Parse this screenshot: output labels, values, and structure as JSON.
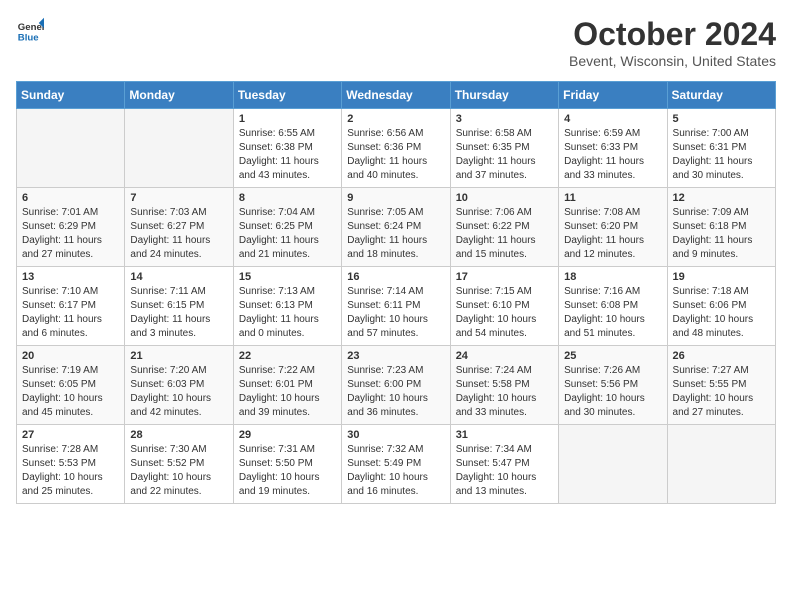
{
  "header": {
    "logo": {
      "general": "General",
      "blue": "Blue"
    },
    "title": "October 2024",
    "subtitle": "Bevent, Wisconsin, United States"
  },
  "weekdays": [
    "Sunday",
    "Monday",
    "Tuesday",
    "Wednesday",
    "Thursday",
    "Friday",
    "Saturday"
  ],
  "weeks": [
    [
      {
        "day": "",
        "info": ""
      },
      {
        "day": "",
        "info": ""
      },
      {
        "day": "1",
        "info": "Sunrise: 6:55 AM\nSunset: 6:38 PM\nDaylight: 11 hours and 43 minutes."
      },
      {
        "day": "2",
        "info": "Sunrise: 6:56 AM\nSunset: 6:36 PM\nDaylight: 11 hours and 40 minutes."
      },
      {
        "day": "3",
        "info": "Sunrise: 6:58 AM\nSunset: 6:35 PM\nDaylight: 11 hours and 37 minutes."
      },
      {
        "day": "4",
        "info": "Sunrise: 6:59 AM\nSunset: 6:33 PM\nDaylight: 11 hours and 33 minutes."
      },
      {
        "day": "5",
        "info": "Sunrise: 7:00 AM\nSunset: 6:31 PM\nDaylight: 11 hours and 30 minutes."
      }
    ],
    [
      {
        "day": "6",
        "info": "Sunrise: 7:01 AM\nSunset: 6:29 PM\nDaylight: 11 hours and 27 minutes."
      },
      {
        "day": "7",
        "info": "Sunrise: 7:03 AM\nSunset: 6:27 PM\nDaylight: 11 hours and 24 minutes."
      },
      {
        "day": "8",
        "info": "Sunrise: 7:04 AM\nSunset: 6:25 PM\nDaylight: 11 hours and 21 minutes."
      },
      {
        "day": "9",
        "info": "Sunrise: 7:05 AM\nSunset: 6:24 PM\nDaylight: 11 hours and 18 minutes."
      },
      {
        "day": "10",
        "info": "Sunrise: 7:06 AM\nSunset: 6:22 PM\nDaylight: 11 hours and 15 minutes."
      },
      {
        "day": "11",
        "info": "Sunrise: 7:08 AM\nSunset: 6:20 PM\nDaylight: 11 hours and 12 minutes."
      },
      {
        "day": "12",
        "info": "Sunrise: 7:09 AM\nSunset: 6:18 PM\nDaylight: 11 hours and 9 minutes."
      }
    ],
    [
      {
        "day": "13",
        "info": "Sunrise: 7:10 AM\nSunset: 6:17 PM\nDaylight: 11 hours and 6 minutes."
      },
      {
        "day": "14",
        "info": "Sunrise: 7:11 AM\nSunset: 6:15 PM\nDaylight: 11 hours and 3 minutes."
      },
      {
        "day": "15",
        "info": "Sunrise: 7:13 AM\nSunset: 6:13 PM\nDaylight: 11 hours and 0 minutes."
      },
      {
        "day": "16",
        "info": "Sunrise: 7:14 AM\nSunset: 6:11 PM\nDaylight: 10 hours and 57 minutes."
      },
      {
        "day": "17",
        "info": "Sunrise: 7:15 AM\nSunset: 6:10 PM\nDaylight: 10 hours and 54 minutes."
      },
      {
        "day": "18",
        "info": "Sunrise: 7:16 AM\nSunset: 6:08 PM\nDaylight: 10 hours and 51 minutes."
      },
      {
        "day": "19",
        "info": "Sunrise: 7:18 AM\nSunset: 6:06 PM\nDaylight: 10 hours and 48 minutes."
      }
    ],
    [
      {
        "day": "20",
        "info": "Sunrise: 7:19 AM\nSunset: 6:05 PM\nDaylight: 10 hours and 45 minutes."
      },
      {
        "day": "21",
        "info": "Sunrise: 7:20 AM\nSunset: 6:03 PM\nDaylight: 10 hours and 42 minutes."
      },
      {
        "day": "22",
        "info": "Sunrise: 7:22 AM\nSunset: 6:01 PM\nDaylight: 10 hours and 39 minutes."
      },
      {
        "day": "23",
        "info": "Sunrise: 7:23 AM\nSunset: 6:00 PM\nDaylight: 10 hours and 36 minutes."
      },
      {
        "day": "24",
        "info": "Sunrise: 7:24 AM\nSunset: 5:58 PM\nDaylight: 10 hours and 33 minutes."
      },
      {
        "day": "25",
        "info": "Sunrise: 7:26 AM\nSunset: 5:56 PM\nDaylight: 10 hours and 30 minutes."
      },
      {
        "day": "26",
        "info": "Sunrise: 7:27 AM\nSunset: 5:55 PM\nDaylight: 10 hours and 27 minutes."
      }
    ],
    [
      {
        "day": "27",
        "info": "Sunrise: 7:28 AM\nSunset: 5:53 PM\nDaylight: 10 hours and 25 minutes."
      },
      {
        "day": "28",
        "info": "Sunrise: 7:30 AM\nSunset: 5:52 PM\nDaylight: 10 hours and 22 minutes."
      },
      {
        "day": "29",
        "info": "Sunrise: 7:31 AM\nSunset: 5:50 PM\nDaylight: 10 hours and 19 minutes."
      },
      {
        "day": "30",
        "info": "Sunrise: 7:32 AM\nSunset: 5:49 PM\nDaylight: 10 hours and 16 minutes."
      },
      {
        "day": "31",
        "info": "Sunrise: 7:34 AM\nSunset: 5:47 PM\nDaylight: 10 hours and 13 minutes."
      },
      {
        "day": "",
        "info": ""
      },
      {
        "day": "",
        "info": ""
      }
    ]
  ]
}
